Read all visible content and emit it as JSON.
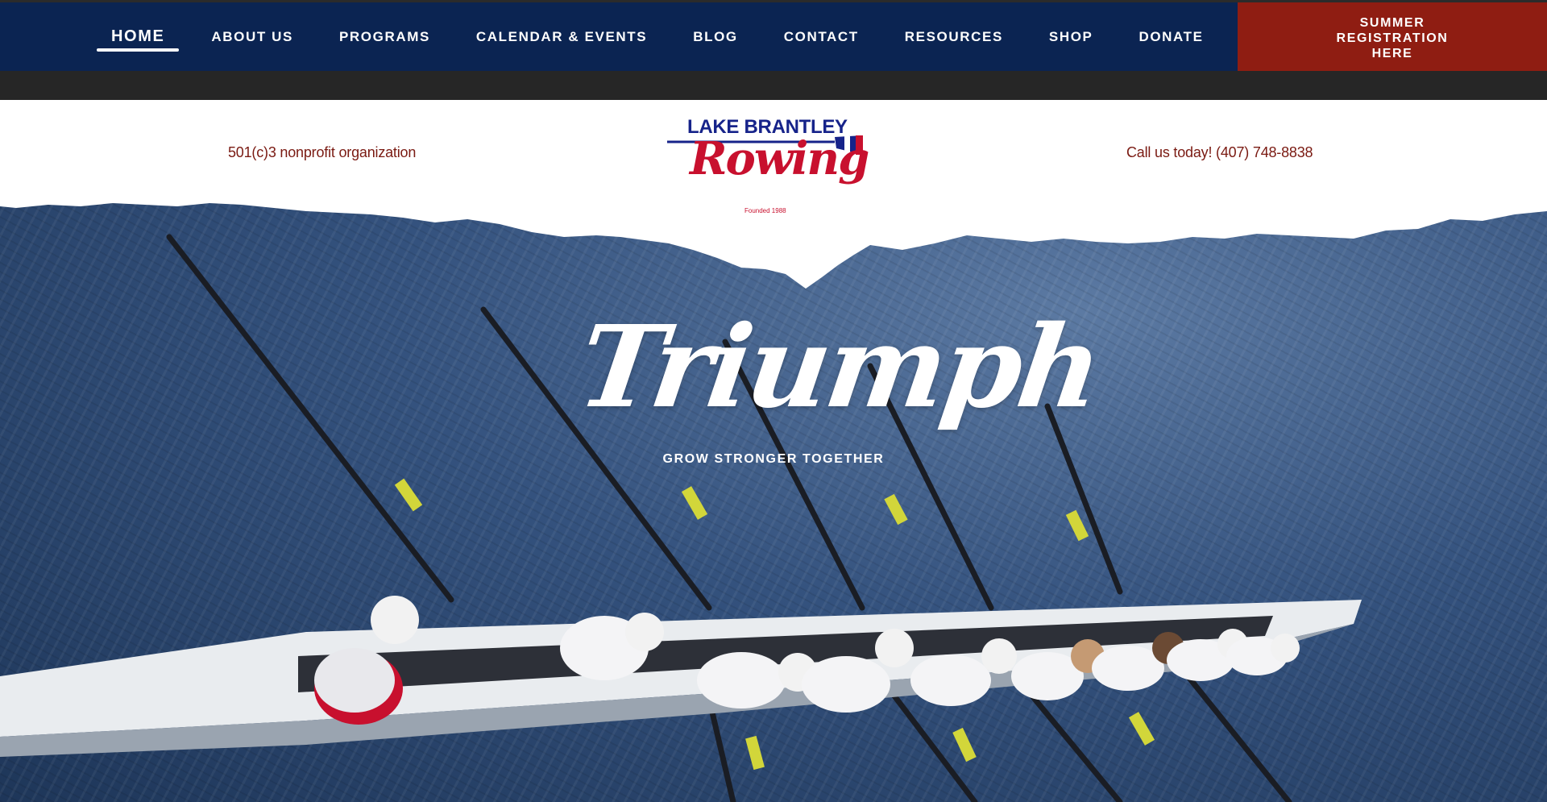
{
  "nav": {
    "items": [
      {
        "label": "HOME"
      },
      {
        "label": "ABOUT US"
      },
      {
        "label": "PROGRAMS"
      },
      {
        "label": "CALENDAR & EVENTS"
      },
      {
        "label": "BLOG"
      },
      {
        "label": "CONTACT"
      },
      {
        "label": "RESOURCES"
      },
      {
        "label": "SHOP"
      },
      {
        "label": "DONATE"
      }
    ],
    "cta_label": "SUMMER REGISTRATION HERE"
  },
  "header": {
    "left_text": "501(c)3 nonprofit organization",
    "right_text": "Call us today! (407) 748-8838",
    "logo": {
      "top_text": "LAKE BRANTLEY",
      "script_text": "Rowing",
      "founded_text": "Founded 1988"
    }
  },
  "hero": {
    "title": "Triumph",
    "subtitle": "GROW STRONGER TOGETHER"
  },
  "colors": {
    "nav_bg": "#0b2452",
    "cta_bg": "#8f1d12",
    "accent_red": "#c8102e",
    "logo_blue": "#16238a"
  }
}
